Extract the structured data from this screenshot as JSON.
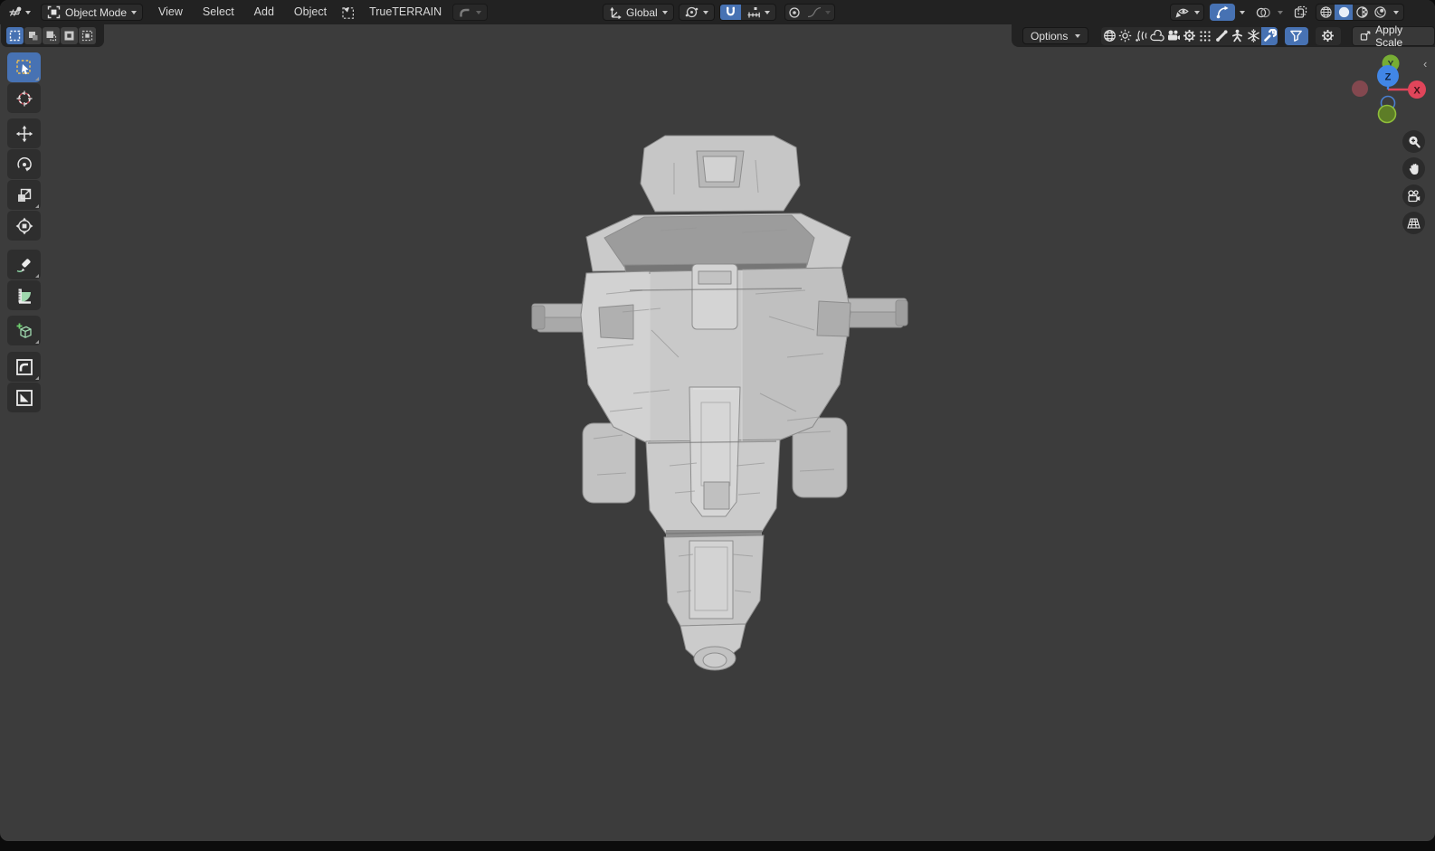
{
  "header": {
    "editor_type": "3D Viewport",
    "mode": {
      "label": "Object Mode"
    },
    "menus": [
      {
        "label": "View"
      },
      {
        "label": "Select"
      },
      {
        "label": "Add"
      },
      {
        "label": "Object"
      }
    ],
    "addon_menu_label": "TrueTERRAIN",
    "transform_orientation": {
      "label": "Global"
    },
    "snapping_enabled": true,
    "gizmos_enabled": true,
    "shading_mode": "solid"
  },
  "tool_settings": {
    "options_label": "Options",
    "apply_scale_label": "Apply Scale",
    "select_mode_active": "set",
    "select_modes": [
      "select-set",
      "select-extend",
      "select-subtract",
      "select-invert",
      "select-intersect"
    ],
    "filter_icons": [
      "world",
      "light",
      "force-field",
      "metaball",
      "camera",
      "gear",
      "particles",
      "bone",
      "armature",
      "physics",
      "modifier-wrench",
      "filter-funnel",
      "settings-gear"
    ],
    "modifier_wrench_active": true,
    "filter_funnel_active": true
  },
  "toolbar": {
    "active_tool": "select-box",
    "tools": [
      "select-box",
      "cursor",
      "move",
      "rotate",
      "scale",
      "transform",
      "annotate",
      "measure",
      "add-cube",
      "fillet",
      "flatten"
    ]
  },
  "nav_gizmo": {
    "x_label": "X",
    "y_label": "Y",
    "z_label": "Z"
  },
  "viewport": {
    "model": "gray low-poly spaceship, top view"
  },
  "colors": {
    "accent_blue": "#4772b3",
    "header_bg": "#222222",
    "viewport_bg": "#3c3c3c",
    "axis_x_red": "#e0455a",
    "axis_y_green": "#77ad34",
    "axis_z_blue": "#4186e6",
    "model_gray": "#c9c9c9"
  },
  "icons": {
    "editor-type-icon": "3d-viewport grid+sphere",
    "object-mode-icon": "square with corner brackets",
    "chevron-down-icon": "▾",
    "paste-flat-icon": "dashed square with corner wedge",
    "fillet-corner-icon": "rounded corner in square",
    "orientation-axes-icon": "two axes arrows",
    "pivot-point-icon": "circle with dots",
    "magnet-icon": "snap magnet",
    "snap-increment-icon": "ruler ticks with square",
    "proportional-icon": "circle with dot",
    "falloff-curve-icon": "bell curve",
    "visibility-eye-icon": "pointer + eye",
    "gizmo-arc-icon": "arc arrow with dot",
    "overlays-icon": "two circles",
    "xray-icon": "overlapping squares",
    "shading-wireframe-icon": "wire sphere",
    "shading-solid-icon": "solid sphere",
    "shading-material-icon": "checker sphere",
    "shading-rendered-icon": "shaded sphere",
    "zoom-icon": "magnifier +",
    "pan-hand-icon": "hand",
    "camera-view-icon": "movie camera",
    "ortho-grid-icon": "perspective grid",
    "sidebar-toggle-icon": "‹"
  }
}
